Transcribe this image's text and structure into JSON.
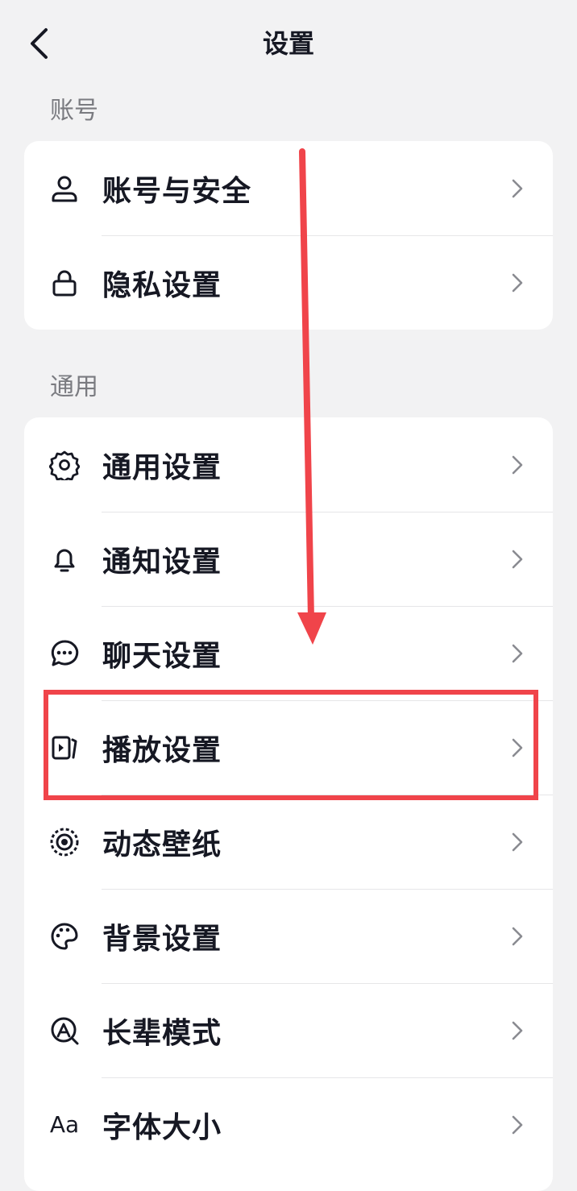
{
  "header": {
    "title": "设置",
    "back_icon": "chevron-left-icon"
  },
  "sections": [
    {
      "label": "账号",
      "items": [
        {
          "label": "账号与安全",
          "icon": "user-icon"
        },
        {
          "label": "隐私设置",
          "icon": "lock-icon"
        }
      ]
    },
    {
      "label": "通用",
      "items": [
        {
          "label": "通用设置",
          "icon": "gear-icon"
        },
        {
          "label": "通知设置",
          "icon": "bell-icon"
        },
        {
          "label": "聊天设置",
          "icon": "chat-bubble-icon"
        },
        {
          "label": "播放设置",
          "icon": "play-screen-icon"
        },
        {
          "label": "动态壁纸",
          "icon": "dynamic-wallpaper-icon"
        },
        {
          "label": "背景设置",
          "icon": "palette-icon"
        },
        {
          "label": "长辈模式",
          "icon": "elder-mode-icon"
        },
        {
          "label": "字体大小",
          "icon": "font-size-icon",
          "icon_text": "Aa"
        }
      ]
    }
  ],
  "annotation": {
    "highlighted_item": "播放设置",
    "color": "#f0444a"
  }
}
